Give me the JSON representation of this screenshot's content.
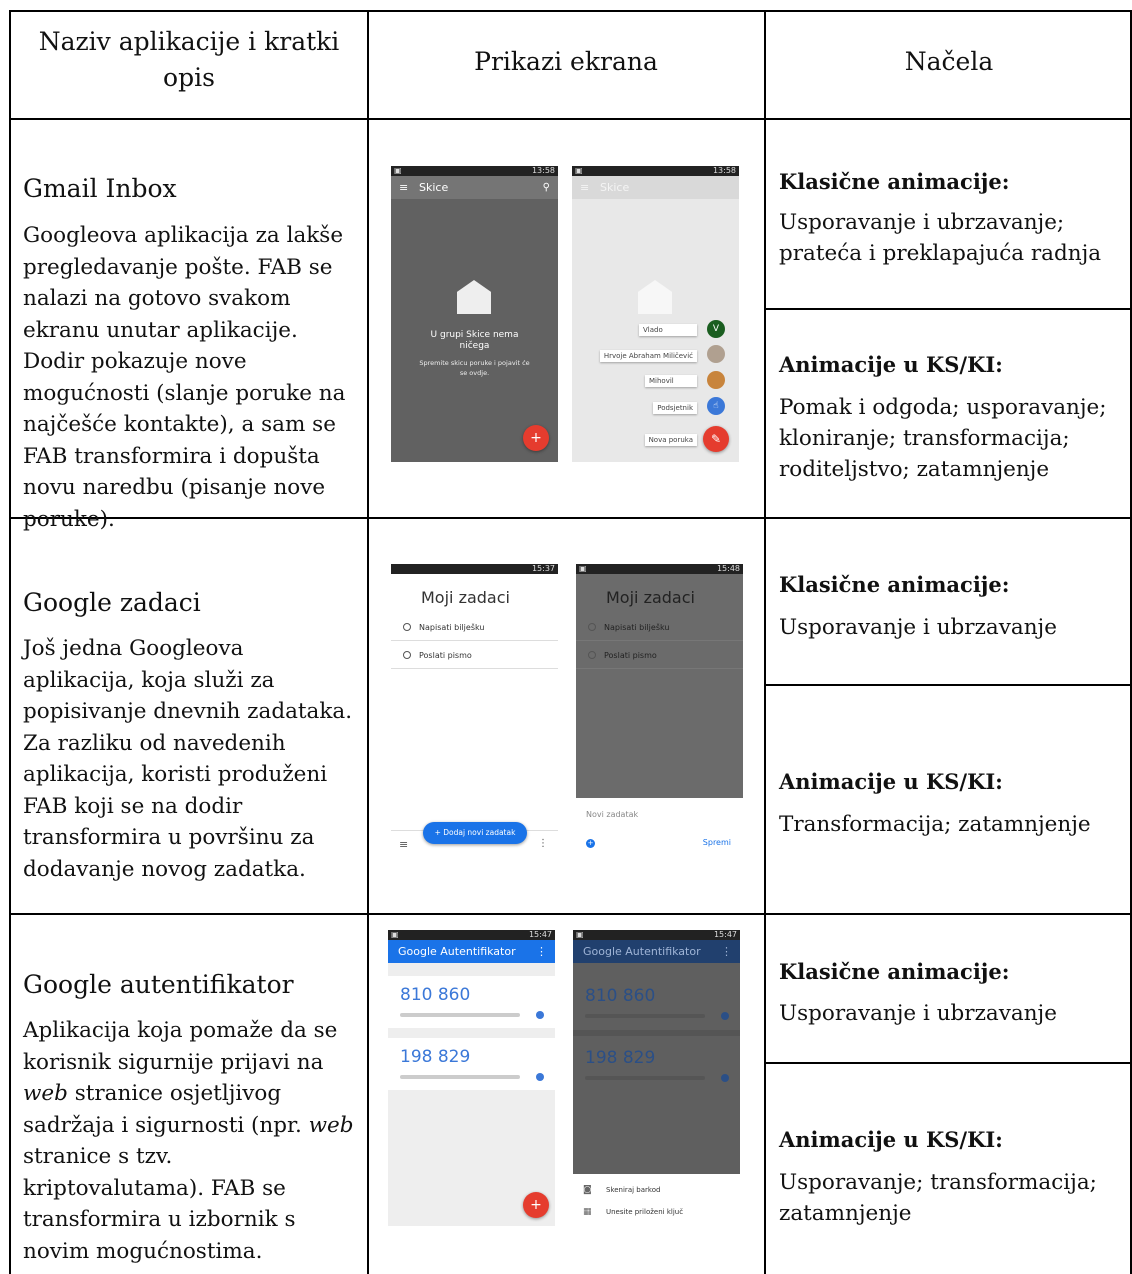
{
  "headers": {
    "app": "Naziv aplikacije i kratki opis",
    "screens": "Prikazi ekrana",
    "principles": "Načela"
  },
  "rows": [
    {
      "title": "Gmail Inbox",
      "description": "Googleova aplikacija za lakše pregledavanje pošte. FAB se nalazi na gotovo svakom ekranu unutar aplikacije. Dodir pokazuje nove mogućnosti (slanje poruke na najčešće kontakte), a sam se FAB transformira i dopušta novu naredbu (pisanje nove poruke).",
      "classic_label": "Klasične animacije:",
      "classic_text": "Usporavanje i ubrzavanje; prateća i preklapajuća radnja",
      "ksi_label": "Animacije u KS/KI:",
      "ksi_text": "Pomak i odgoda; usporavanje; kloniranje; transformacija; roditeljstvo; zatamnjenje",
      "screen1": {
        "status": "13:58",
        "appbar": "Skice",
        "empty_title": "U grupi Skice nema ničega",
        "empty_sub": "Spremite skicu poruke i pojavit će se ovdje.",
        "fab": "+"
      },
      "screen2": {
        "status": "13:58",
        "appbar": "Skice",
        "contacts": [
          "Vlado",
          "Hrvoje Abraham Miličević",
          "Mihovil",
          "Podsjetnik",
          "Nova poruka"
        ],
        "avatar_v": "V"
      }
    },
    {
      "title": "Google zadaci",
      "description": "Još jedna Googleova aplikacija, koja služi za popisivanje dnevnih zadataka. Za razliku od navedenih aplikacija, koristi produženi FAB koji se na dodir transformira u površinu za dodavanje novog zadatka.",
      "classic_label": "Klasične animacije:",
      "classic_text": "Usporavanje i ubrzavanje",
      "ksi_label": "Animacije u KS/KI:",
      "ksi_text": "Transformacija; zatamnjenje",
      "screen1": {
        "status": "15:37",
        "heading": "Moji zadaci",
        "tasks": [
          "Napisati bilješku",
          "Poslati pismo"
        ],
        "fab": "+ Dodaj novi zadatak"
      },
      "screen2": {
        "status": "15:48",
        "heading": "Moji zadaci",
        "tasks": [
          "Napisati bilješku",
          "Poslati pismo"
        ],
        "new_task_placeholder": "Novi zadatak",
        "save": "Spremi"
      }
    },
    {
      "title": "Google autentifikator",
      "description_parts": [
        "Aplikacija koja pomaže da se korisnik sigurnije prijavi na ",
        "web",
        " stranice osjetljivog sadržaja i sigurnosti (npr. ",
        "web",
        " stranice s tzv. kriptovalutama). FAB se transformira u izbornik s novim mogućnostima."
      ],
      "classic_label": "Klasične animacije:",
      "classic_text": "Usporavanje i ubrzavanje",
      "ksi_label": "Animacije u KS/KI:",
      "ksi_text": "Usporavanje; transformacija; zatamnjenje",
      "screen1": {
        "status": "15:47",
        "appbar": "Google Autentifikator",
        "codes": [
          "810 860",
          "198 829"
        ],
        "fab": "+"
      },
      "screen2": {
        "status": "15:47",
        "appbar": "Google Autentifikator",
        "codes": [
          "810 860",
          "198 829"
        ],
        "menu": [
          "Skeniraj barkod",
          "Unesite priloženi ključ"
        ]
      }
    }
  ]
}
